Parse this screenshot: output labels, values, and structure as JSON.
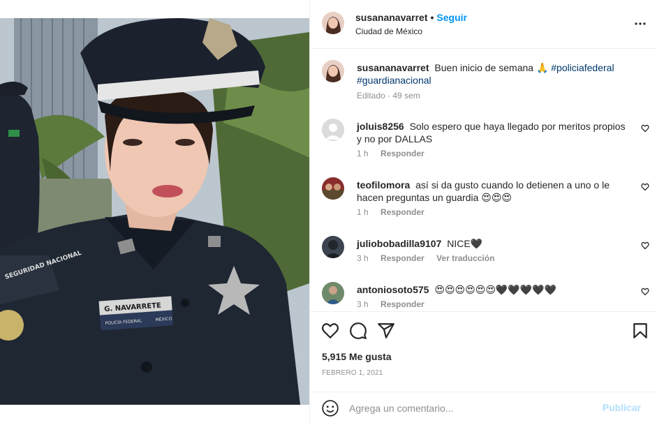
{
  "post": {
    "author": "susananavarret",
    "follow_label": "Seguir",
    "location": "Ciudad de México",
    "caption": {
      "username": "susananavarret",
      "text": "Buen inicio de semana 🙏",
      "hashtags": [
        "#policiafederal",
        "#guardianacional"
      ],
      "edited": "Editado · 49 sem"
    },
    "badge_text": "G. NAVARRETE",
    "badge_sub": "POLICÍA FEDERAL",
    "badge_sub2": "MÉXICO",
    "shoulder_text": "SEGURIDAD NACIONAL"
  },
  "comments": [
    {
      "username": "joluis8256",
      "text": "Solo espero que haya llegado por meritos propios y no por DALLAS",
      "time": "1 h",
      "reply": "Responder",
      "translate": ""
    },
    {
      "username": "teofilomora",
      "text": "así si da gusto cuando lo detienen a uno o le hacen preguntas un guardia 😍😍😍",
      "time": "1 h",
      "reply": "Responder",
      "translate": ""
    },
    {
      "username": "juliobobadilla9107",
      "text": "NICE🖤",
      "time": "3 h",
      "reply": "Responder",
      "translate": "Ver traducción"
    },
    {
      "username": "antoniosoto575",
      "text": "😍😍😍😍😍😍🖤🖤🖤🖤🖤",
      "time": "3 h",
      "reply": "Responder",
      "translate": ""
    }
  ],
  "stats": {
    "likes": "5,915 Me gusta",
    "date": "FEBRERO 1, 2021"
  },
  "composer": {
    "placeholder": "Agrega un comentario...",
    "publish_label": "Publicar"
  },
  "icons": {
    "more": "more-horizontal-icon",
    "like": "heart-icon",
    "comment": "comment-icon",
    "share": "paper-plane-icon",
    "save": "bookmark-icon",
    "emoji": "emoji-icon"
  },
  "colors": {
    "link": "#0095f6",
    "hashtag": "#00376b",
    "muted": "#8e8e8e",
    "publish_disabled": "#b2dffc"
  }
}
